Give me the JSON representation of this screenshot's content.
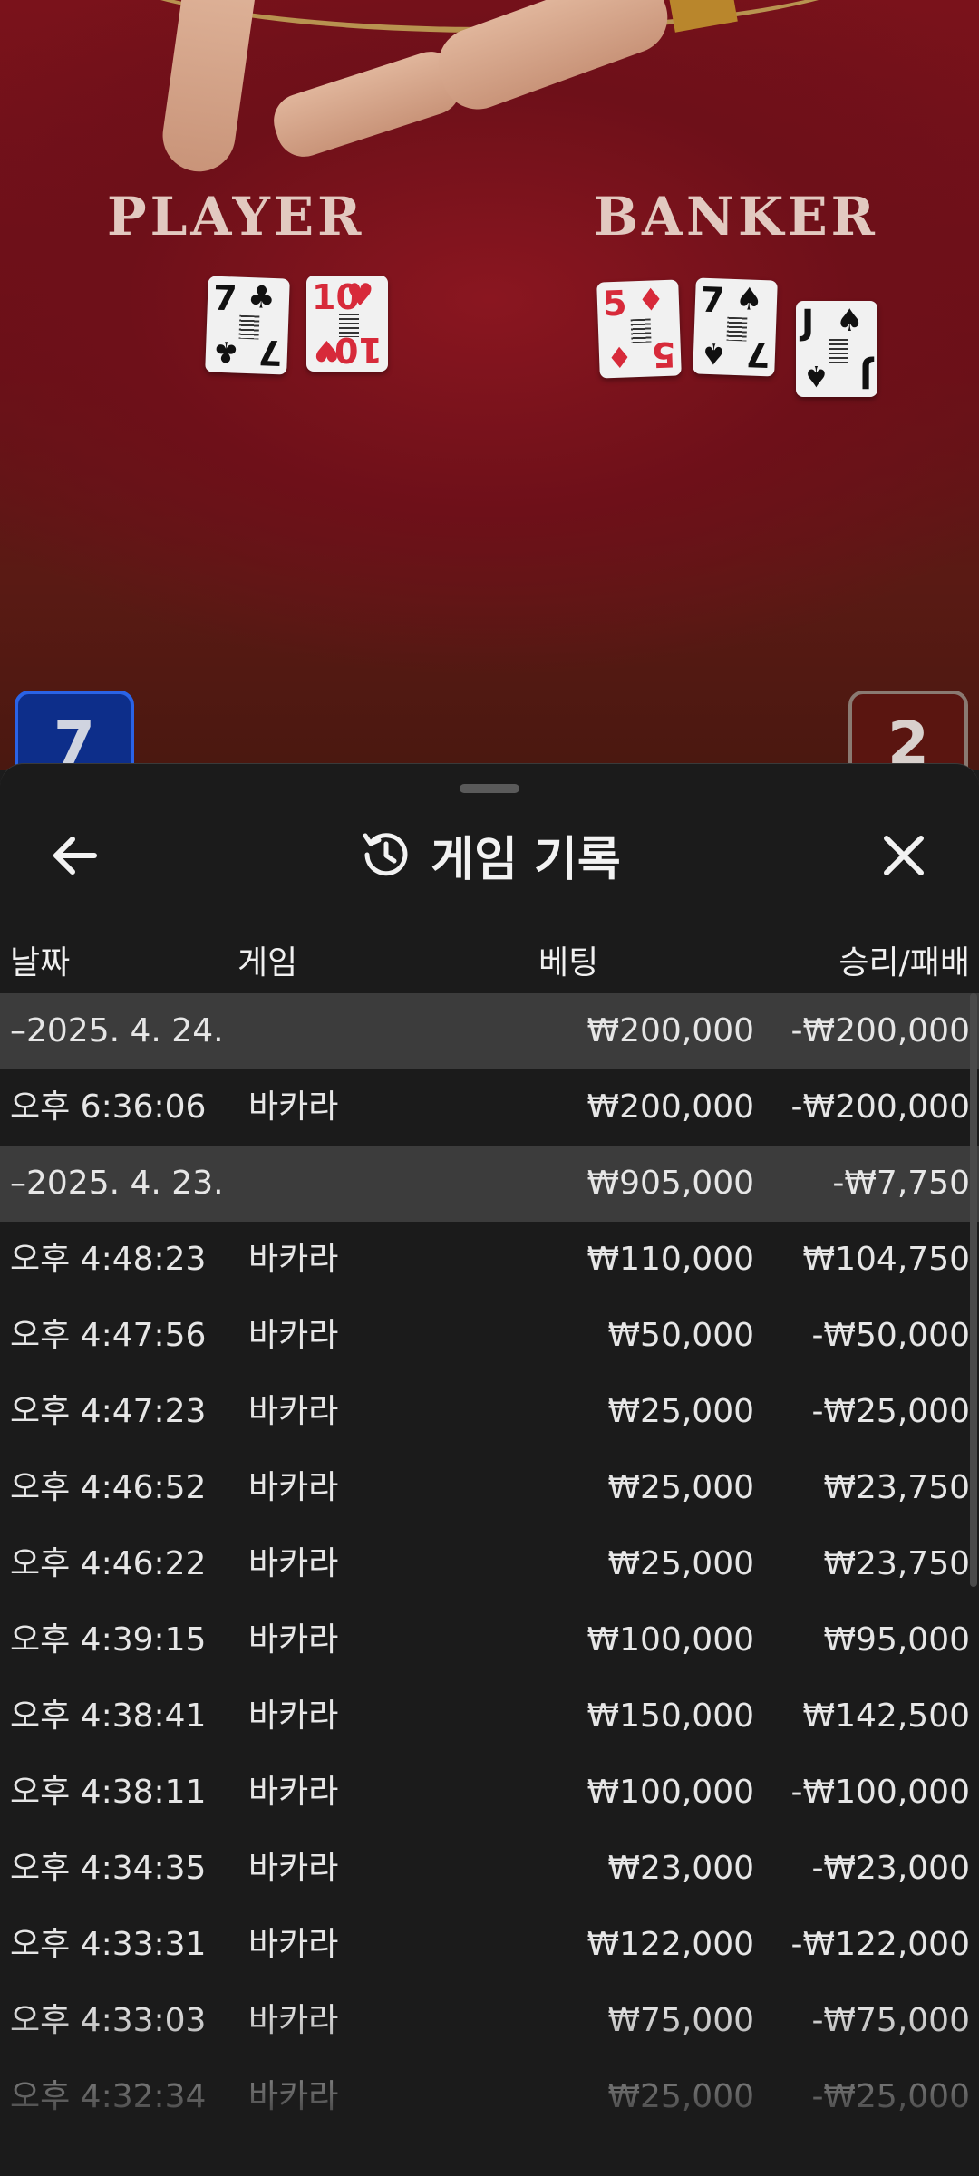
{
  "table": {
    "player_label": "PLAYER",
    "banker_label": "BANKER",
    "player_cards": [
      {
        "rank": "7",
        "suit": "♣",
        "color": "blk"
      },
      {
        "rank": "10",
        "suit": "♥",
        "color": "red"
      }
    ],
    "banker_cards": [
      {
        "rank": "5",
        "suit": "♦",
        "color": "red"
      },
      {
        "rank": "7",
        "suit": "♠",
        "color": "blk"
      },
      {
        "rank": "J",
        "suit": "♠",
        "color": "blk"
      }
    ],
    "player_score": "7",
    "banker_score": "2"
  },
  "sheet": {
    "title": "게임 기록",
    "icons": {
      "back": "arrow-left-icon",
      "history": "history-icon",
      "close": "close-icon"
    },
    "columns": {
      "date": "날짜",
      "game": "게임",
      "bet": "베팅",
      "result": "승리/패배"
    },
    "rows": [
      {
        "type": "group",
        "date": "–2025. 4. 24.",
        "game": "",
        "bet": "₩200,000",
        "result": "-₩200,000"
      },
      {
        "type": "item",
        "date": "오후 6:36:06",
        "game": "바카라",
        "bet": "₩200,000",
        "result": "-₩200,000"
      },
      {
        "type": "group",
        "date": "–2025. 4. 23.",
        "game": "",
        "bet": "₩905,000",
        "result": "-₩7,750"
      },
      {
        "type": "item",
        "date": "오후 4:48:23",
        "game": "바카라",
        "bet": "₩110,000",
        "result": "₩104,750"
      },
      {
        "type": "item",
        "date": "오후 4:47:56",
        "game": "바카라",
        "bet": "₩50,000",
        "result": "-₩50,000"
      },
      {
        "type": "item",
        "date": "오후 4:47:23",
        "game": "바카라",
        "bet": "₩25,000",
        "result": "-₩25,000"
      },
      {
        "type": "item",
        "date": "오후 4:46:52",
        "game": "바카라",
        "bet": "₩25,000",
        "result": "₩23,750"
      },
      {
        "type": "item",
        "date": "오후 4:46:22",
        "game": "바카라",
        "bet": "₩25,000",
        "result": "₩23,750"
      },
      {
        "type": "item",
        "date": "오후 4:39:15",
        "game": "바카라",
        "bet": "₩100,000",
        "result": "₩95,000"
      },
      {
        "type": "item",
        "date": "오후 4:38:41",
        "game": "바카라",
        "bet": "₩150,000",
        "result": "₩142,500"
      },
      {
        "type": "item",
        "date": "오후 4:38:11",
        "game": "바카라",
        "bet": "₩100,000",
        "result": "-₩100,000"
      },
      {
        "type": "item",
        "date": "오후 4:34:35",
        "game": "바카라",
        "bet": "₩23,000",
        "result": "-₩23,000"
      },
      {
        "type": "item",
        "date": "오후 4:33:31",
        "game": "바카라",
        "bet": "₩122,000",
        "result": "-₩122,000"
      },
      {
        "type": "item",
        "date": "오후 4:33:03",
        "game": "바카라",
        "bet": "₩75,000",
        "result": "-₩75,000"
      },
      {
        "type": "item",
        "date": "오후 4:32:34",
        "game": "바카라",
        "bet": "₩25,000",
        "result": "-₩25,000"
      }
    ]
  }
}
